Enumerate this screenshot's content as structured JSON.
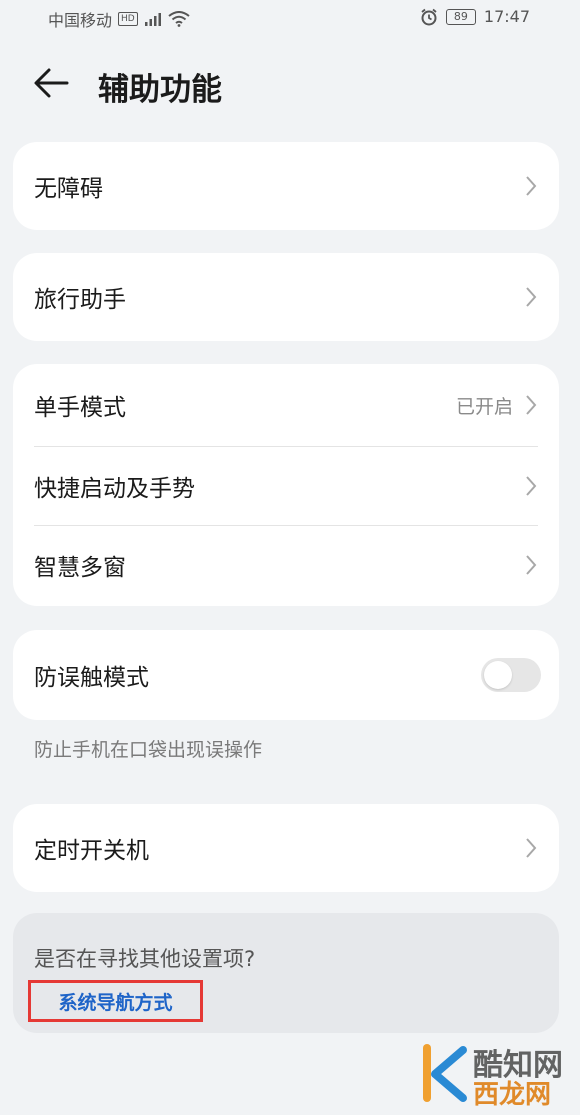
{
  "status_bar": {
    "carrier": "中国移动",
    "hd": "HD",
    "battery": "89",
    "time": "17:47"
  },
  "header": {
    "title": "辅助功能"
  },
  "items": {
    "accessibility": "无障碍",
    "travel_assistant": "旅行助手",
    "one_hand_mode": "单手模式",
    "one_hand_mode_value": "已开启",
    "shortcuts_gestures": "快捷启动及手势",
    "smart_multiwindow": "智慧多窗",
    "pocket_mode": "防误触模式",
    "pocket_mode_on": false,
    "pocket_mode_desc": "防止手机在口袋出现误操作",
    "scheduled_power": "定时开关机"
  },
  "suggestion": {
    "question": "是否在寻找其他设置项?",
    "link": "系统导航方式"
  },
  "watermark": {
    "line1": "酷知网",
    "line2": "西龙网"
  },
  "colors": {
    "background": "#f1f3f5",
    "card": "#ffffff",
    "link": "#1e64c8",
    "highlight_box": "#e53935"
  }
}
